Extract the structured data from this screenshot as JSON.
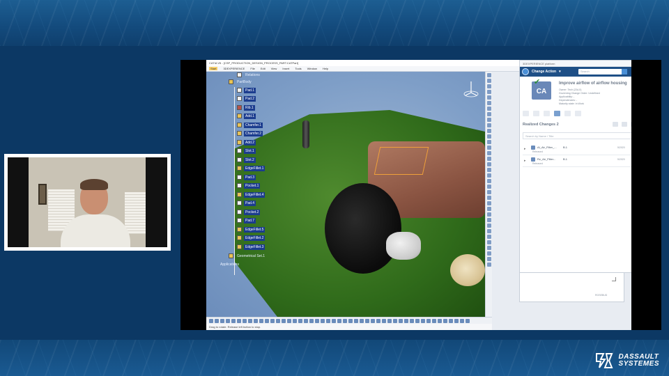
{
  "brand": {
    "line1": "DASSAULT",
    "line2": "SYSTEMES"
  },
  "catia": {
    "window_title": "CATIA V5 - [CSP_PRODUCTION_DESIGN_PROCESS_PART.CATPart]",
    "window_controls": [
      "–",
      "□",
      "×"
    ],
    "menu": [
      "Start",
      "3DEXPERIENCE",
      "File",
      "Edit",
      "View",
      "Insert",
      "Tools",
      "Window",
      "Help"
    ],
    "status_text": "Drag to rotate. Release left button to stop.",
    "tree": {
      "top_items": [
        "Relations",
        "PartBody"
      ],
      "features": [
        "Pad.1",
        "Pad.2",
        "Rib.1",
        "Add.1",
        "Chamfer.1",
        "Chamfer.2",
        "Add.2",
        "Slot.1",
        "Slot.2",
        "EdgeFillet.1",
        "Pad.3",
        "Pocket.1",
        "EdgeFillet.4",
        "Pad.4",
        "Pocket.2",
        "Pad.7",
        "EdgeFillet.5",
        "EdgeFillet.2",
        "EdgeFillet.3"
      ],
      "geometrical_set": "Geometrical Set.1",
      "applications": "Applications"
    }
  },
  "panel": {
    "header": "3DEXPERIENCE platform",
    "tool_name": "Change Action",
    "search_placeholder": "Search",
    "ca_icon_text": "CA",
    "title": "Improve airflow of airflow housing",
    "meta": [
      "Owner: Tech (ZALX)",
      "Governing Change Order: Undefined",
      "Applicability: -",
      "Dependencies: -",
      "Maturity state: In Work"
    ],
    "realized_changes_label": "Realized Changes",
    "realized_changes_count": "2",
    "filter_placeholder": "Search by Name / Title",
    "rows": [
      {
        "name": "AI_Air_Filter_...",
        "version": "B.1",
        "state": "Released",
        "date": "5/2020"
      },
      {
        "name": "Rz_Air_Filter...",
        "version": "B.1",
        "state": "Released",
        "date": "5/2020"
      }
    ],
    "sub_label": "ROSEBUD"
  }
}
